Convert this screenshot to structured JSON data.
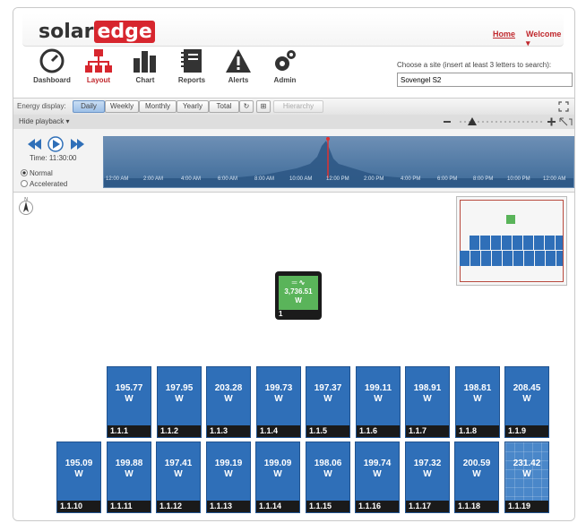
{
  "header": {
    "logo_left": "solar",
    "logo_right": "edge",
    "home_link": "Home",
    "welcome_menu": "Welcome ▾"
  },
  "nav": [
    {
      "label": "Dashboard",
      "icon": "gauge-icon",
      "active": false
    },
    {
      "label": "Layout",
      "icon": "hierarchy-icon",
      "active": true
    },
    {
      "label": "Chart",
      "icon": "bar-chart-icon",
      "active": false
    },
    {
      "label": "Reports",
      "icon": "notebook-icon",
      "active": false
    },
    {
      "label": "Alerts",
      "icon": "warning-icon",
      "active": false
    },
    {
      "label": "Admin",
      "icon": "gears-icon",
      "active": false
    }
  ],
  "site_search": {
    "label": "Choose a site (insert at least 3 letters to search):",
    "value": "Sovengel S2"
  },
  "toolbar": {
    "energy_label": "Energy display:",
    "buttons": [
      "Daily",
      "Weekly",
      "Monthly",
      "Yearly",
      "Total"
    ],
    "active": "Daily",
    "hierarchy_label": "Hierarchy"
  },
  "playback": {
    "hide_label": "Hide playback ▾",
    "time": "Time: 11:30:00",
    "modes": [
      "Normal",
      "Accelerated"
    ],
    "selected_mode": "Normal",
    "time_labels": [
      "12:00 AM",
      "2:00 AM",
      "4:00 AM",
      "6:00 AM",
      "8:00 AM",
      "10:00 AM",
      "12:00 PM",
      "2:00 PM",
      "4:00 PM",
      "6:00 PM",
      "8:00 PM",
      "10:00 PM",
      "12:00 AM"
    ]
  },
  "inverter": {
    "power": "3,736.51",
    "unit": "W",
    "id": "1"
  },
  "panel_unit": "W",
  "panels": [
    {
      "id": "1.1.1",
      "power": "195.77"
    },
    {
      "id": "1.1.2",
      "power": "197.95"
    },
    {
      "id": "1.1.3",
      "power": "203.28"
    },
    {
      "id": "1.1.4",
      "power": "199.73"
    },
    {
      "id": "1.1.5",
      "power": "197.37"
    },
    {
      "id": "1.1.6",
      "power": "199.11"
    },
    {
      "id": "1.1.7",
      "power": "198.91"
    },
    {
      "id": "1.1.8",
      "power": "198.81"
    },
    {
      "id": "1.1.9",
      "power": "208.45"
    },
    {
      "id": "1.1.10",
      "power": "195.09"
    },
    {
      "id": "1.1.11",
      "power": "199.88"
    },
    {
      "id": "1.1.12",
      "power": "197.41"
    },
    {
      "id": "1.1.13",
      "power": "199.19"
    },
    {
      "id": "1.1.14",
      "power": "199.09"
    },
    {
      "id": "1.1.15",
      "power": "198.06"
    },
    {
      "id": "1.1.16",
      "power": "199.74"
    },
    {
      "id": "1.1.17",
      "power": "197.32"
    },
    {
      "id": "1.1.18",
      "power": "200.59"
    },
    {
      "id": "1.1.19",
      "power": "231.42"
    }
  ],
  "colors": {
    "brand_red": "#d7262e",
    "panel_blue": "#2f6fb8",
    "inverter_green": "#5ab45a"
  }
}
